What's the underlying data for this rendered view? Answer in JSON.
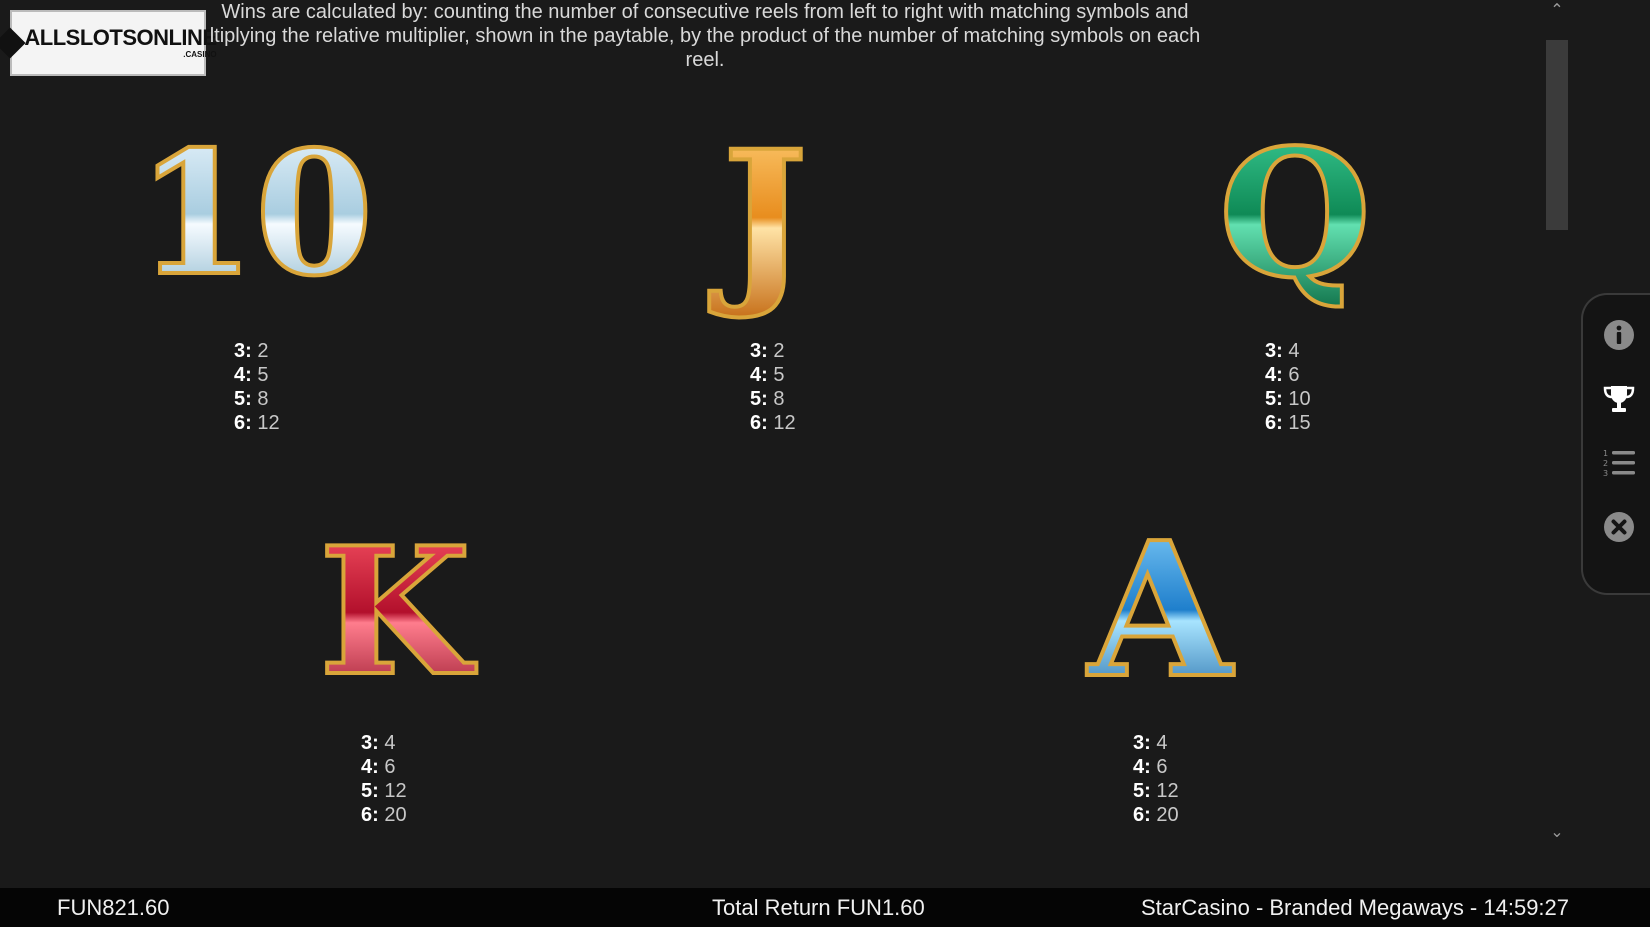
{
  "logo": {
    "text": "ALLSLOTSONLINE",
    "sub": ".CASINO"
  },
  "intro": {
    "line1": "Wins are calculated by: counting the number of consecutive reels from left to right with matching symbols and",
    "line2": "ltiplying the relative multiplier, shown in the paytable, by the product of the number of matching symbols on each",
    "line3": "reel."
  },
  "symbols": [
    {
      "name": "10",
      "color": "#cfe8f4",
      "pays": [
        {
          "k": "3:",
          "v": "2"
        },
        {
          "k": "4:",
          "v": "5"
        },
        {
          "k": "5:",
          "v": "8"
        },
        {
          "k": "6:",
          "v": "12"
        }
      ]
    },
    {
      "name": "J",
      "color": "#f0a83a",
      "pays": [
        {
          "k": "3:",
          "v": "2"
        },
        {
          "k": "4:",
          "v": "5"
        },
        {
          "k": "5:",
          "v": "8"
        },
        {
          "k": "6:",
          "v": "12"
        }
      ]
    },
    {
      "name": "Q",
      "color": "#1fa06a",
      "pays": [
        {
          "k": "3:",
          "v": "4"
        },
        {
          "k": "4:",
          "v": "6"
        },
        {
          "k": "5:",
          "v": "10"
        },
        {
          "k": "6:",
          "v": "15"
        }
      ]
    },
    {
      "name": "K",
      "color": "#c01a3a",
      "pays": [
        {
          "k": "3:",
          "v": "4"
        },
        {
          "k": "4:",
          "v": "6"
        },
        {
          "k": "5:",
          "v": "12"
        },
        {
          "k": "6:",
          "v": "20"
        }
      ]
    },
    {
      "name": "A",
      "color": "#2a8fd6",
      "pays": [
        {
          "k": "3:",
          "v": "4"
        },
        {
          "k": "4:",
          "v": "6"
        },
        {
          "k": "5:",
          "v": "12"
        },
        {
          "k": "6:",
          "v": "20"
        }
      ]
    }
  ],
  "scroll": {
    "up": "⌃",
    "down": "⌄"
  },
  "side_menu": [
    {
      "icon": "info-icon"
    },
    {
      "icon": "trophy-icon"
    },
    {
      "icon": "numbered-list-icon"
    },
    {
      "icon": "close-icon"
    }
  ],
  "footer": {
    "balance": "FUN821.60",
    "total_return": "Total Return FUN1.60",
    "title_time": "StarCasino - Branded Megaways - 14:59:27"
  },
  "colors": {
    "gold": "#d9a53a",
    "background": "#1a1a1a",
    "bar": "#050505"
  }
}
